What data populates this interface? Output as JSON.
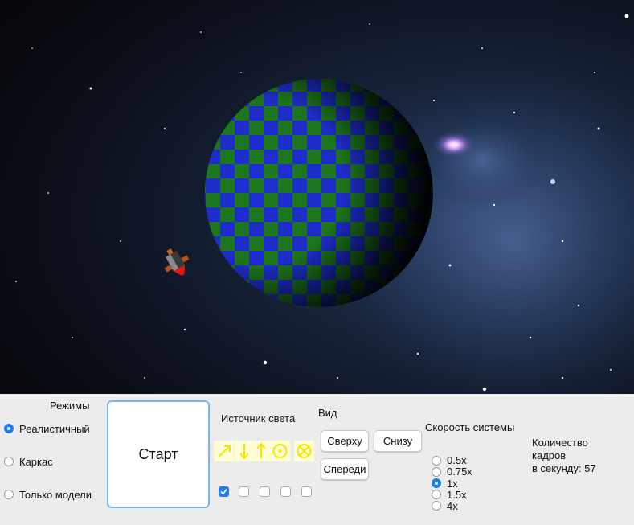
{
  "modes": {
    "title": "Режимы",
    "options": [
      {
        "label": "Реалистичный",
        "selected": true
      },
      {
        "label": "Каркас",
        "selected": false
      },
      {
        "label": "Только модели",
        "selected": false
      }
    ]
  },
  "start_button": {
    "label": "Старт"
  },
  "light_source": {
    "title": "Источник света",
    "directions": [
      {
        "icon": "arrow-up-right-icon",
        "enabled": true
      },
      {
        "icon": "arrow-down-icon",
        "enabled": false
      },
      {
        "icon": "arrow-up-icon",
        "enabled": false
      },
      {
        "icon": "circle-dot-icon",
        "enabled": false
      },
      {
        "icon": "circle-cross-icon",
        "enabled": false
      }
    ],
    "icon_color": "#f5e600"
  },
  "view": {
    "title": "Вид",
    "top": "Сверху",
    "bottom": "Снизу",
    "front": "Спереди"
  },
  "speed": {
    "title": "Скорость системы",
    "options": [
      {
        "label": "0.5x",
        "selected": false
      },
      {
        "label": "0.75x",
        "selected": false
      },
      {
        "label": "1x",
        "selected": true
      },
      {
        "label": "1.5x",
        "selected": false
      },
      {
        "label": "4x",
        "selected": false
      }
    ]
  },
  "fps": {
    "line1": "Количество",
    "line2": "кадров",
    "line3_prefix": "в секунду:",
    "value": "57"
  },
  "colors": {
    "accent": "#1a7cf5",
    "planet_blue": "#1f2fd2",
    "planet_green": "#1e7a1e",
    "space": "#0b0e16"
  }
}
